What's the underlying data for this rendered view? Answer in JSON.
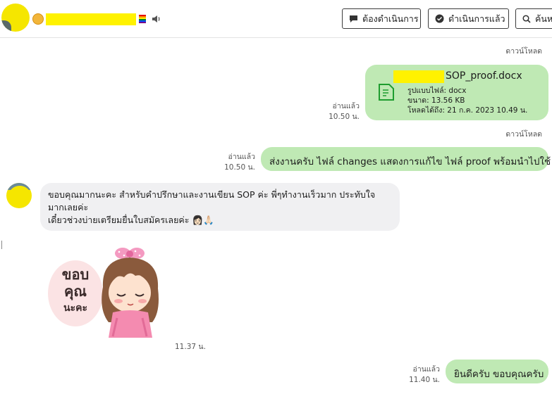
{
  "header": {
    "name_prefix_icon": "sun-emoji",
    "flag_icon": "rainbow-flag",
    "buttons": {
      "todo": "ต้องดำเนินการ",
      "done": "ดำเนินการแล้ว",
      "search": "ค้นหา"
    }
  },
  "messages": {
    "download_label_1": "ดาวน์โหลด",
    "file": {
      "name": "SOP_proof.docx",
      "format": "รูปแบบไฟล์: docx",
      "size": "ขนาด: 13.56 KB",
      "expires": "โหลดได้ถึง: 21 ก.ค. 2023 10.49 น.",
      "read_label": "อ่านแล้ว",
      "time": "10.50 น."
    },
    "download_label_2": "ดาวน์โหลด",
    "outgoing_1": {
      "text": "ส่งงานครับ ไฟล์ changes แสดงการแก้ไข ไฟล์ proof พร้อมนำไปใช้",
      "read_label": "อ่านแล้ว",
      "time": "10.50 น."
    },
    "incoming_1": {
      "line1": "ขอบคุณมากนะคะ สำหรับคำปรึกษาและงานเขียน SOP ค่ะ พี่ๆทำงานเร็วมาก ประทับใจ",
      "line2": "มากเลยค่ะ",
      "line3": "เดี๋ยวช่วงบ่ายเตรียมยื่นใบสมัครเลยค่ะ 👩🏻🙏🏻"
    },
    "sticker": {
      "text1": "ขอบ",
      "text2": "คุณ",
      "text3": "นะคะ",
      "time": "11.37 น."
    },
    "outgoing_2": {
      "text": "ยินดีครับ ขอบคุณครับ",
      "read_label": "อ่านแล้ว",
      "time": "11.40 น."
    }
  },
  "colors": {
    "outgoing_bubble": "#bfe9b4",
    "incoming_bubble": "#f0f0f2",
    "redaction": "#fff200",
    "file_icon": "#1f9d2f"
  }
}
